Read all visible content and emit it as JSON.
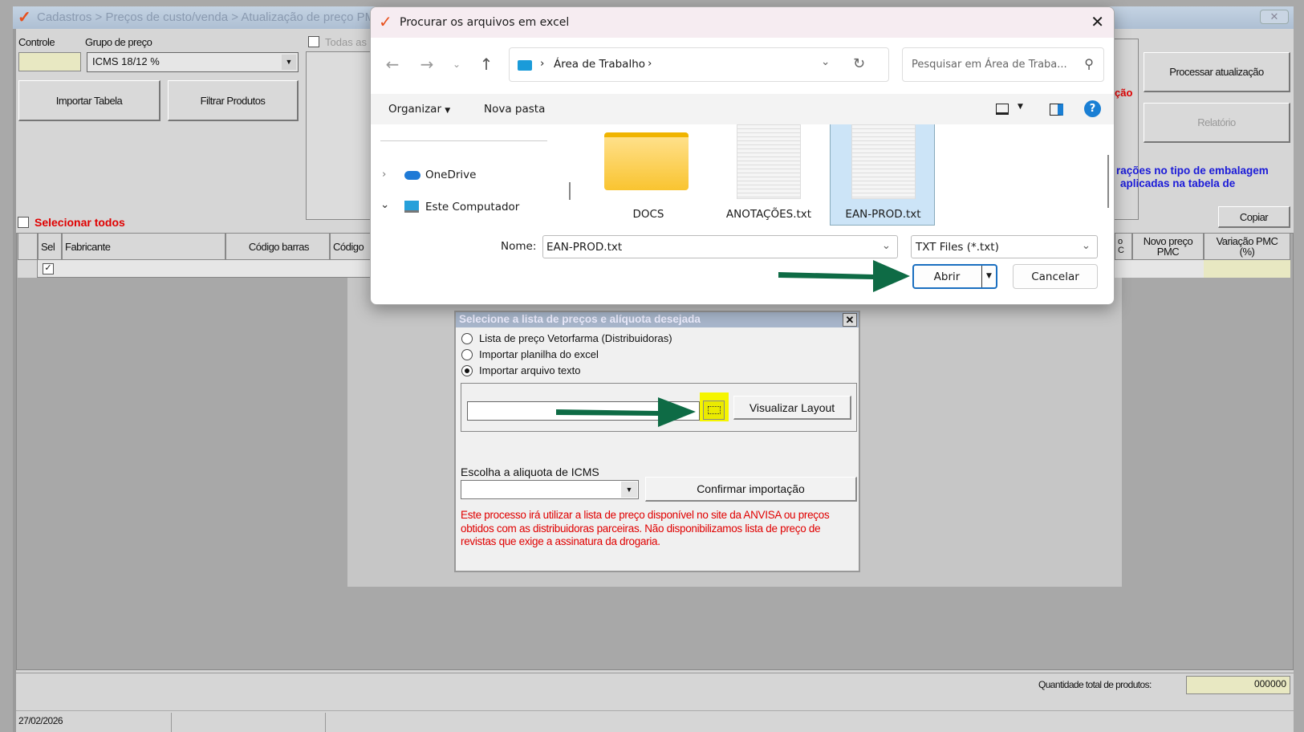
{
  "app": {
    "breadcrumb": "Cadastros > Preços de custo/venda > Atualização de preço PMC",
    "controle_label": "Controle",
    "controle_value": "",
    "grupo_label": "Grupo de preço",
    "grupo_value": "ICMS 18/12 %",
    "importar_btn": "Importar Tabela",
    "filtrar_btn": "Filtrar Produtos",
    "todas_label": "Todas as",
    "selecionar_todos": "Selecionar todos",
    "processar_btn": "Processar atualização",
    "relatorio_btn": "Relatório",
    "red_partial": "ção",
    "blue_note_1": "rações no tipo de embalagem",
    "blue_note_2": "aplicadas na tabela de",
    "copiar_btn": "Copiar",
    "columns": {
      "sel": "Sel",
      "fabricante": "Fabricante",
      "codigo_barras": "Código barras",
      "codigo": "Código",
      "partial": "o\nC",
      "novo_preco": "Novo preço PMC",
      "variacao": "Variação PMC (%)"
    },
    "row_checked": true,
    "qtd_label": "Quantidade total de produtos:",
    "qtd_value": "000000",
    "status_date": "27/02/2026"
  },
  "file_dialog": {
    "title": "Procurar os arquivos em excel",
    "path": [
      "Área de Trabalho"
    ],
    "search_placeholder": "Pesquisar em Área de Traba...",
    "organizar": "Organizar",
    "nova_pasta": "Nova pasta",
    "nav": [
      {
        "label": "OneDrive",
        "expanded": false
      },
      {
        "label": "Este Computador",
        "expanded": true
      }
    ],
    "files": [
      {
        "name": "DOCS",
        "type": "folder"
      },
      {
        "name": "ANOTAÇÕES.txt",
        "type": "txt"
      },
      {
        "name": "EAN-PROD.txt",
        "type": "txt",
        "selected": true
      }
    ],
    "nome_label": "Nome:",
    "nome_value": "EAN-PROD.txt",
    "filetype": "TXT Files (*.txt)",
    "abrir": "Abrir",
    "cancelar": "Cancelar"
  },
  "import_dialog": {
    "title": "Selecione a lista de preços e alíquota desejada",
    "options": [
      "Lista de preço Vetorfarma (Distribuidoras)",
      "Importar planilha do excel",
      "Importar arquivo texto"
    ],
    "selected_option": 2,
    "file_value": "",
    "visualizar_btn": "Visualizar Layout",
    "icms_label": "Escolha a aliquota de ICMS",
    "icms_value": "",
    "confirmar_btn": "Confirmar importação",
    "warning": "Este processo irá utilizar a lista de preço disponível no site da ANVISA ou preços obtidos com as distribuidoras parceiras. Não disponibilizamos lista de preço de revistas que exige a assinatura da drogaria."
  },
  "colors": {
    "arrow": "#0e6b45",
    "highlight": "#f5f500",
    "warning": "#e00000",
    "blue_note": "#1a1ad8"
  }
}
